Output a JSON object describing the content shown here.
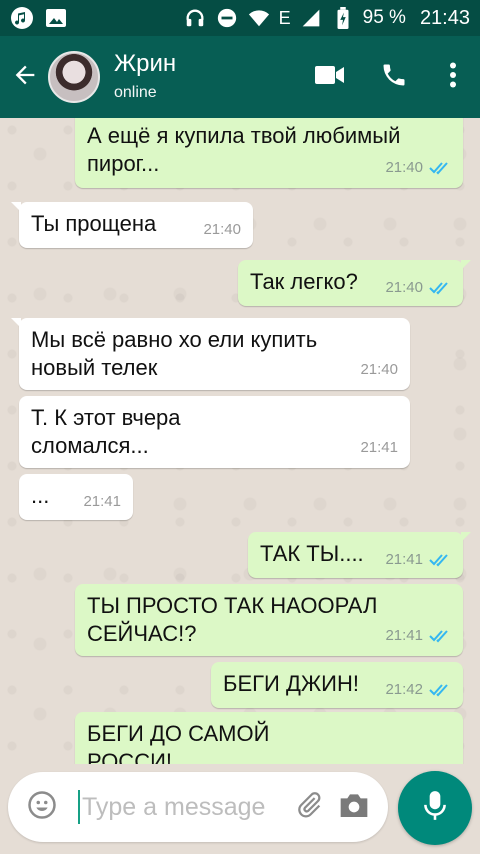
{
  "status_bar": {
    "battery": "95 %",
    "time": "21:43"
  },
  "header": {
    "title": "Жрин",
    "subtitle": "online"
  },
  "messages": [
    {
      "dir": "out",
      "text": "А ещё я купила твой любимый пирог...",
      "time": "21:40",
      "read": true
    },
    {
      "dir": "in",
      "text": "Ты прощена",
      "time": "21:40"
    },
    {
      "dir": "out",
      "text": "Так легко?",
      "time": "21:40",
      "read": true
    },
    {
      "dir": "in",
      "text": "Мы всё равно хо ели купить новый телек",
      "time": "21:40"
    },
    {
      "dir": "in",
      "text": "Т. К этот вчера сломался...",
      "time": "21:41"
    },
    {
      "dir": "in",
      "text": "...",
      "time": "21:41"
    },
    {
      "dir": "out",
      "text": "ТАК ТЫ....",
      "time": "21:41",
      "read": true
    },
    {
      "dir": "out",
      "text": "ТЫ ПРОСТО ТАК НАООРАЛ СЕЙЧАС!?",
      "time": "21:41",
      "read": true
    },
    {
      "dir": "out",
      "text": "БЕГИ ДЖИН!",
      "time": "21:42",
      "read": true
    },
    {
      "dir": "out",
      "text": "БЕГИ ДО САМОЙ РОССИ!",
      "time": "",
      "read": true
    }
  ],
  "composer": {
    "placeholder": "Type a message"
  },
  "colors": {
    "header": "#075e54",
    "statusbar": "#054d44",
    "outgoing": "#dcf8c6",
    "incoming": "#ffffff",
    "accent": "#00897b",
    "read_tick": "#34b7f1"
  },
  "icons": [
    "music-note-icon",
    "image-icon",
    "headphones-icon",
    "do-not-disturb-icon",
    "wifi-icon",
    "signal-icon",
    "battery-icon",
    "back-arrow-icon",
    "video-call-icon",
    "phone-icon",
    "more-vert-icon",
    "emoji-icon",
    "attach-icon",
    "camera-icon",
    "mic-icon",
    "double-tick-icon"
  ]
}
